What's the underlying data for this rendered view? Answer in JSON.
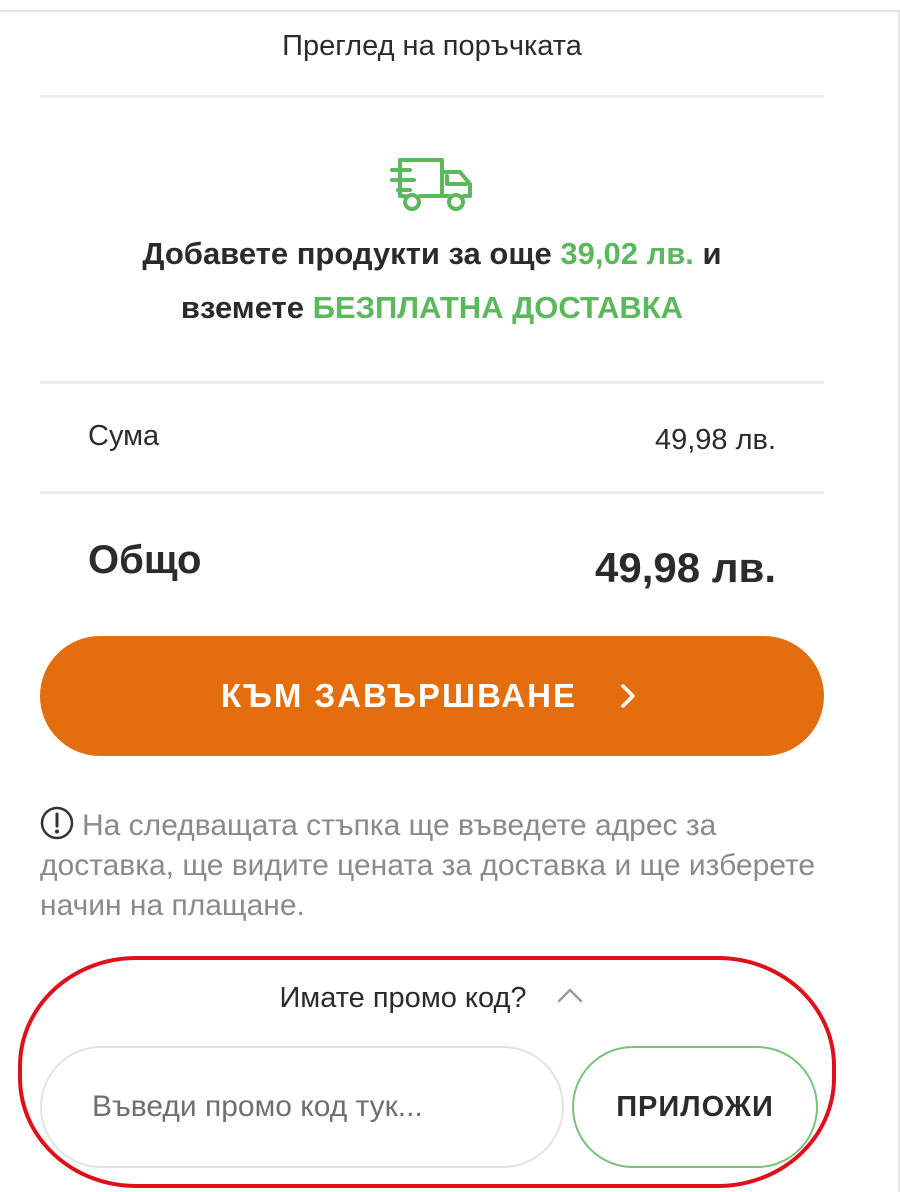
{
  "summary": {
    "title": "Преглед на поръчката"
  },
  "free_shipping": {
    "icon": "delivery-truck-icon",
    "line1_prefix": "Добавете продукти за още ",
    "amount_left": "39,02 лв.",
    "line1_suffix": " и",
    "line2_prefix": "вземете ",
    "free_delivery_label": "БЕЗПЛАТНА ДОСТАВКА",
    "accent_color": "#5cb85c"
  },
  "totals": {
    "sum_label": "Сума",
    "sum_value": "49,98 лв.",
    "total_label": "Общо",
    "total_value": "49,98 лв."
  },
  "checkout": {
    "button_label": "КЪМ ЗАВЪРШВАНЕ",
    "button_icon": "chevron-right-icon",
    "button_color": "#e46d0e"
  },
  "notice": {
    "icon": "info-icon",
    "text": "На следващата стъпка ще въведете адрес за доставка, ще видите цената за доставка и ще изберете начин на плащане."
  },
  "promo": {
    "toggle_label": "Имате промо код?",
    "toggle_icon": "chevron-up-icon",
    "input_value": "",
    "input_placeholder": "Въведи промо код тук...",
    "apply_label": "ПРИЛОЖИ",
    "highlight_color": "#e0101a"
  }
}
